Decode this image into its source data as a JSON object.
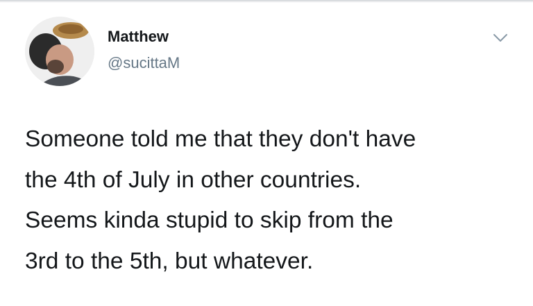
{
  "tweet": {
    "author": {
      "display_name": "Matthew",
      "handle": "@sucittaM",
      "avatar_icon": "avatar-photo"
    },
    "menu_icon": "chevron-down-icon",
    "text": "Someone told me that they don't have\nthe 4th of July in other countries.\nSeems kinda stupid to skip from the\n3rd to the 5th, but whatever."
  },
  "colors": {
    "name": "#14171a",
    "handle": "#657786",
    "body_text": "#14171a",
    "chevron": "#8899a6",
    "background": "#ffffff"
  }
}
